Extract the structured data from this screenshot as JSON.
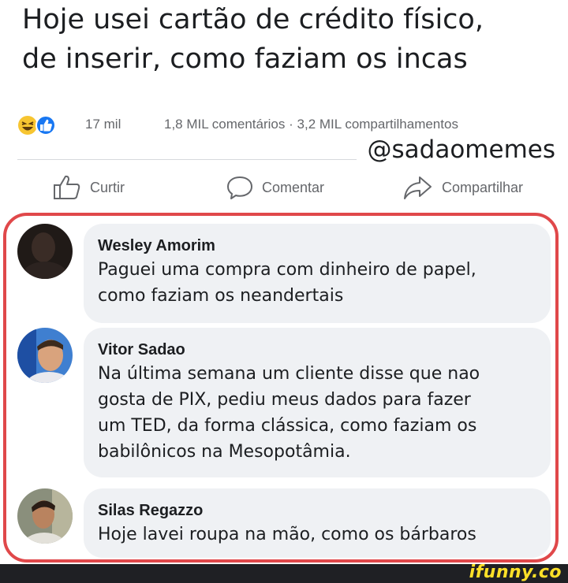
{
  "post": {
    "text_line1": "Hoje usei cartão de crédito físico,",
    "text_line2": "de inserir, como faziam os incas"
  },
  "reactions": {
    "icons": [
      "haha-emoji-icon",
      "like-icon"
    ],
    "count": "17 mil",
    "comments_count": "1,8 MIL comentários",
    "separator": "·",
    "shares_count": "3,2 MIL compartilhamentos"
  },
  "watermark_handle": "@sadaomemes",
  "actions": {
    "like_label": "Curtir",
    "comment_label": "Comentar",
    "share_label": "Compartilhar"
  },
  "comments": [
    {
      "author": "Wesley Amorim",
      "lines": [
        "Paguei uma compra com dinheiro de papel,",
        "como faziam os neandertais"
      ]
    },
    {
      "author": "Vitor Sadao",
      "lines": [
        "Na última semana um cliente disse que nao",
        "gosta de PIX, pediu meus dados para fazer",
        "um TED, da forma clássica, como faziam os",
        "babilônicos na Mesopotâmia."
      ]
    },
    {
      "author": "Silas Regazzo",
      "lines": [
        "Hoje lavei roupa na mão, como os bárbaros"
      ]
    }
  ],
  "branding": {
    "ifunny": "ifunny.co"
  },
  "colors": {
    "highlight_border": "#e0484a",
    "bubble_bg": "#eff1f4",
    "like_blue": "#1877f2",
    "haha_yellow": "#f7c531",
    "ifunny_yellow": "#fde028"
  }
}
